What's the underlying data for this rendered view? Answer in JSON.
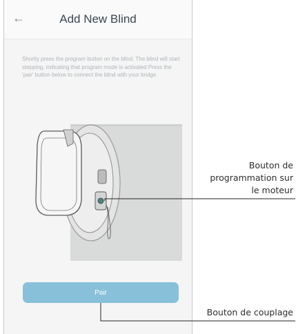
{
  "header": {
    "back_icon": "arrow-left-icon",
    "title": "Add New Blind"
  },
  "instructions": "Shortly press the program button on the blind. The blind will start stepping, indicating that program mode is activated Press the 'pair' button below to connect the blind with your bridge",
  "pair_button": {
    "label": "Pair"
  },
  "callouts": {
    "program_button": "Bouton de programmation sur le moteur",
    "pair_button": "Bouton de couplage"
  },
  "colors": {
    "accent": "#88c0d9",
    "title": "#3b4650",
    "instruction_text": "#aeb4b9"
  }
}
